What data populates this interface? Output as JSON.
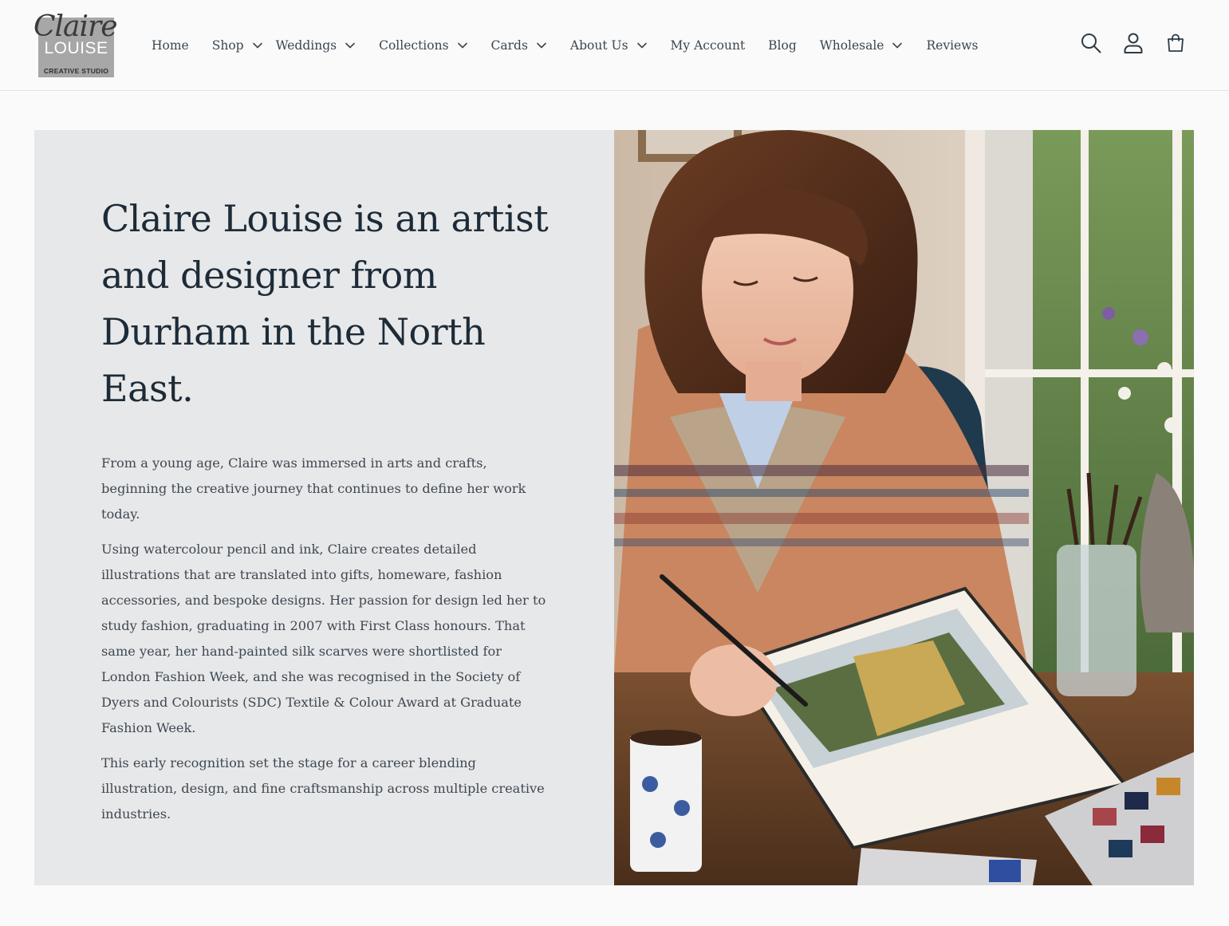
{
  "brand": {
    "script": "Claire",
    "name": "LOUISE",
    "tagline": "CREATIVE STUDIO"
  },
  "nav": {
    "items": [
      {
        "label": "Home",
        "dropdown": false
      },
      {
        "label": "Shop",
        "dropdown": true
      },
      {
        "label": "Weddings",
        "dropdown": true
      },
      {
        "label": "Collections",
        "dropdown": true
      },
      {
        "label": "Cards",
        "dropdown": true
      },
      {
        "label": "About Us",
        "dropdown": true
      },
      {
        "label": "My Account",
        "dropdown": false
      },
      {
        "label": "Blog",
        "dropdown": false
      },
      {
        "label": "Wholesale",
        "dropdown": true
      },
      {
        "label": "Reviews",
        "dropdown": false
      }
    ]
  },
  "header_icons": [
    "search-icon",
    "account-icon",
    "cart-icon"
  ],
  "hero": {
    "title": "Claire Louise is an artist and designer from Durham in the North East.",
    "paragraphs": [
      "From a young age, Claire was immersed in arts and crafts, beginning the creative journey that continues to define her work today.",
      "Using watercolour pencil and ink, Claire creates detailed illustrations that are translated into gifts, homeware, fashion accessories, and bespoke designs. Her passion for design led her to study fashion, graduating in 2007 with First Class honours. That same year, her hand-painted silk scarves were shortlisted for London Fashion Week, and she was recognised in the Society of Dyers and Colourists (SDC) Textile & Colour Award at Graduate Fashion Week.",
      "This early recognition set the stage for a career blending illustration, design, and fine craftsmanship across multiple creative industries."
    ]
  },
  "colors": {
    "background": "#fafafa",
    "panel": "#e7e8e9",
    "heading": "#1d2b38",
    "body_text": "#3e4852"
  }
}
